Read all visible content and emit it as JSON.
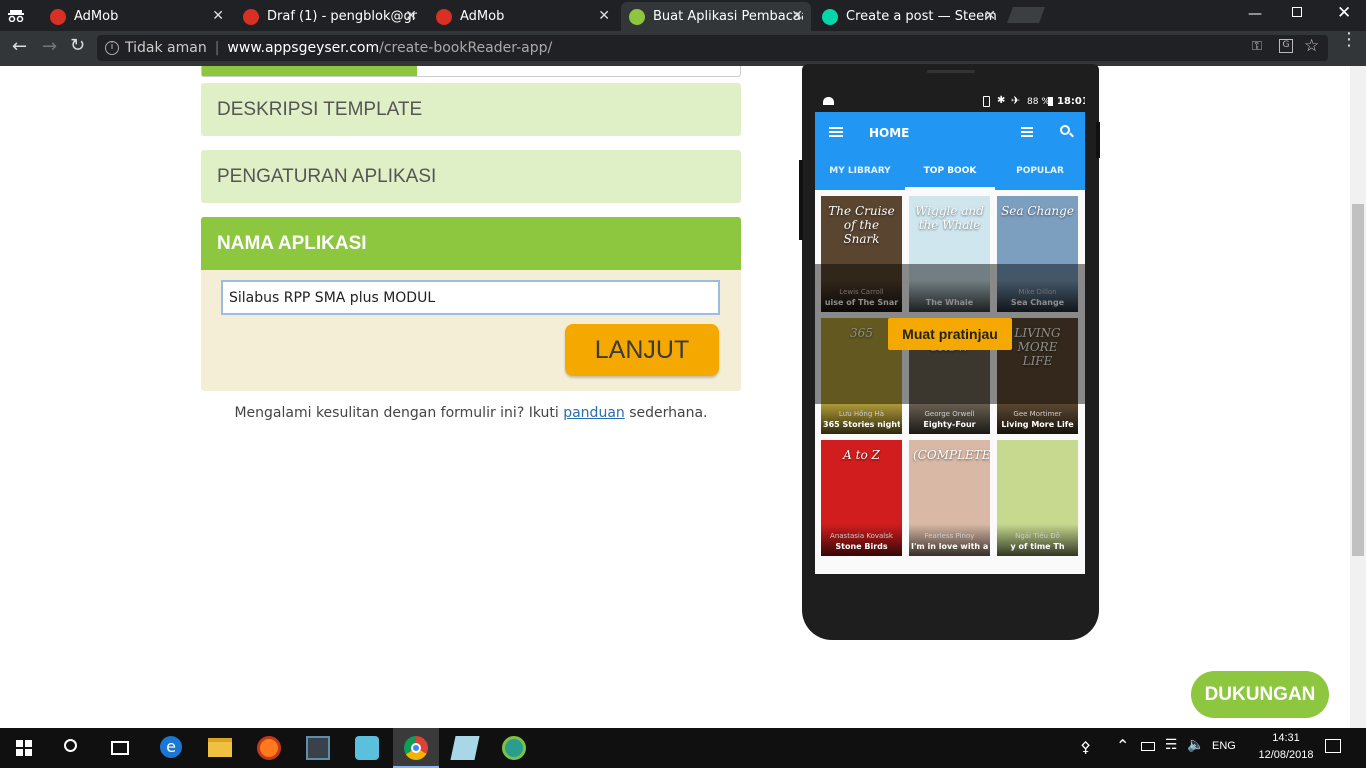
{
  "browser": {
    "tabs": [
      {
        "title": "AdMob",
        "color": "#d93025"
      },
      {
        "title": "Draf (1) - pengblok@gma",
        "color": "#d93025"
      },
      {
        "title": "AdMob",
        "color": "#d93025"
      },
      {
        "title": "Buat Aplikasi Pembacaan",
        "color": "#8dc63f"
      },
      {
        "title": "Create a post — Steemit",
        "color": "#06d6a9"
      }
    ],
    "security": "Tidak aman",
    "url_host": "www.appsgeyser.com",
    "url_path": "/create-bookReader-app/"
  },
  "form": {
    "progress": 0.4,
    "section1": "DESKRIPSI TEMPLATE",
    "section2": "PENGATURAN APLIKASI",
    "section3": "NAMA APLIKASI",
    "app_name_value": "Silabus RPP SMA plus MODUL",
    "next_label": "LANJUT",
    "help_prefix": "Mengalami kesulitan dengan formulir ini? Ikuti ",
    "help_link": "panduan",
    "help_suffix": " sederhana."
  },
  "phone": {
    "status": {
      "battery": "88 %",
      "time": "18:01"
    },
    "toolbar_title": "HOME",
    "tabs": [
      "MY LIBRARY",
      "TOP BOOK",
      "POPULAR"
    ],
    "active_tab": 1,
    "preview_button": "Muat pratinjau",
    "books": [
      {
        "author": "Lewis Carroll",
        "title": "uise of The Snar",
        "bg": "#5a4530",
        "cover": "The Cruise of the Snark"
      },
      {
        "author": "",
        "title": "The Whale",
        "bg": "#cfe6ee",
        "cover": "Wiggle and the Whale"
      },
      {
        "author": "Mike Dillon",
        "title": "Sea Change",
        "bg": "#7d9fbf",
        "cover": "Sea Change"
      },
      {
        "author": "Lưu Hồng Hà",
        "title": "365 Stories night",
        "bg": "#b5a13a",
        "cover": "365"
      },
      {
        "author": "George Orwell",
        "title": "Eighty-Four",
        "bg": "#6c6355",
        "cover": "LITTLE CROW"
      },
      {
        "author": "Gee Mortimer",
        "title": "Living More Life",
        "bg": "#5e4a32",
        "cover": "LIVING MORE LIFE"
      },
      {
        "author": "Anastasia Kovalsk",
        "title": "Stone Birds",
        "bg": "#d11d1d",
        "cover": "A to Z"
      },
      {
        "author": "Fearless Pinoy",
        "title": "I'm in love with a",
        "bg": "#d9b9a6",
        "cover": "(COMPLETE)"
      },
      {
        "author": "Ngải Tiểu Đỗ",
        "title": "y of time Th",
        "bg": "#c6d98f",
        "cover": ""
      }
    ]
  },
  "support_label": "DUKUNGAN",
  "taskbar": {
    "lang": "ENG",
    "time": "14:31",
    "date": "12/08/2018"
  }
}
